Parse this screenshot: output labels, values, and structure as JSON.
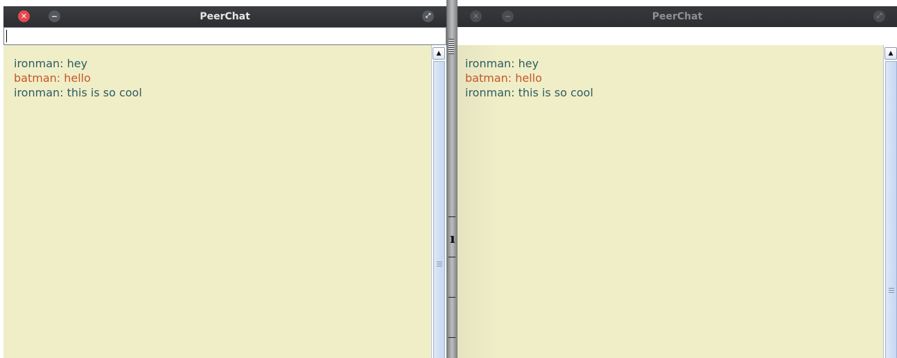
{
  "windows": [
    {
      "title": "PeerChat",
      "active": true,
      "input_value": "",
      "messages": [
        {
          "text": "ironman: hey",
          "color": "#2d5c63"
        },
        {
          "text": "batman: hello",
          "color": "#c4562a"
        },
        {
          "text": "ironman: this is so cool",
          "color": "#2d5c63"
        }
      ]
    },
    {
      "title": "PeerChat",
      "active": false,
      "input_value": "",
      "messages": [
        {
          "text": "ironman: hey",
          "color": "#2d5c63"
        },
        {
          "text": "batman: hello",
          "color": "#c4562a"
        },
        {
          "text": "ironman: this is so cool",
          "color": "#2d5c63"
        }
      ]
    }
  ],
  "icons": {
    "close": "close-icon",
    "minimize": "minimize-icon",
    "maximize": "maximize-icon",
    "scroll_up": "arrow-up-icon"
  },
  "colors": {
    "chat_background": "#f0eec7",
    "titlebar": "#2f3134",
    "close_button": "#e5484d",
    "user_ironman": "#2d5c63",
    "user_batman": "#c4562a"
  }
}
